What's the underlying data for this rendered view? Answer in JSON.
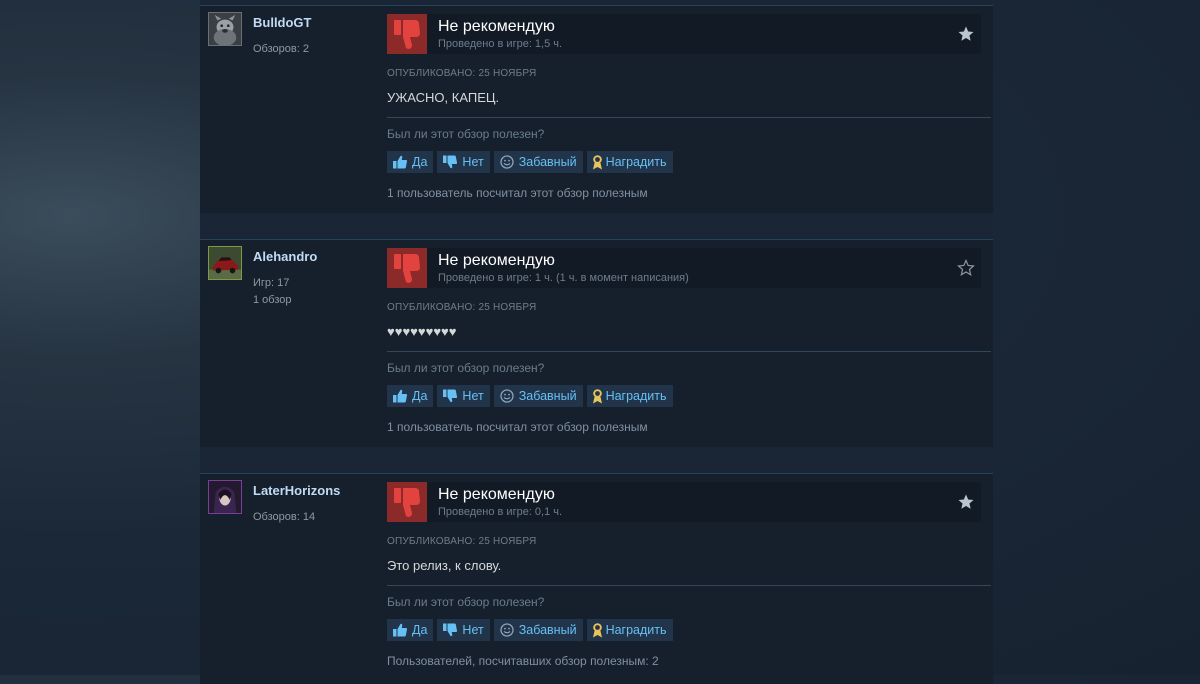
{
  "colors": {
    "page_bg": "#1b2838",
    "review_bg": "#16202d",
    "thumb_red": "#8c2a2a",
    "link_blue": "#66c0f4",
    "award_gold": "#e8c45a"
  },
  "icons": {
    "verdict": "thumbs-down-icon",
    "award_star": "star-icon",
    "yes": "thumbs-up-icon",
    "no": "thumbs-down-icon",
    "funny": "smiley-icon",
    "award": "award-ribbon-icon"
  },
  "reviews": [
    {
      "author": {
        "name": "BulldoGT",
        "stats": [
          "Обзоров: 2"
        ]
      },
      "verdict": "Не рекомендую",
      "hours": "Проведено в игре: 1,5 ч.",
      "award_star_filled": true,
      "posted": "ОПУБЛИКОВАНО: 25 НОЯБРЯ",
      "text": "УЖАСНО, КАПЕЦ.",
      "helpful_question": "Был ли этот обзор полезен?",
      "buttons": {
        "yes": "Да",
        "no": "Нет",
        "funny": "Забавный",
        "award": "Наградить"
      },
      "helpful_count": "1 пользователь посчитал этот обзор полезным"
    },
    {
      "author": {
        "name": "Alehandro",
        "stats": [
          "Игр: 17",
          "1 обзор"
        ]
      },
      "verdict": "Не рекомендую",
      "hours": "Проведено в игре: 1 ч. (1 ч. в момент написания)",
      "award_star_filled": false,
      "posted": "ОПУБЛИКОВАНО: 25 НОЯБРЯ",
      "text": "♥♥♥♥♥♥♥♥♥",
      "helpful_question": "Был ли этот обзор полезен?",
      "buttons": {
        "yes": "Да",
        "no": "Нет",
        "funny": "Забавный",
        "award": "Наградить"
      },
      "helpful_count": "1 пользователь посчитал этот обзор полезным"
    },
    {
      "author": {
        "name": "LaterHorizons",
        "stats": [
          "Обзоров: 14"
        ]
      },
      "verdict": "Не рекомендую",
      "hours": "Проведено в игре: 0,1 ч.",
      "award_star_filled": true,
      "posted": "ОПУБЛИКОВАНО: 25 НОЯБРЯ",
      "text": "Это релиз, к слову.",
      "helpful_question": "Был ли этот обзор полезен?",
      "buttons": {
        "yes": "Да",
        "no": "Нет",
        "funny": "Забавный",
        "award": "Наградить"
      },
      "helpful_count": "Пользователей, посчитавших обзор полезным: 2"
    }
  ]
}
